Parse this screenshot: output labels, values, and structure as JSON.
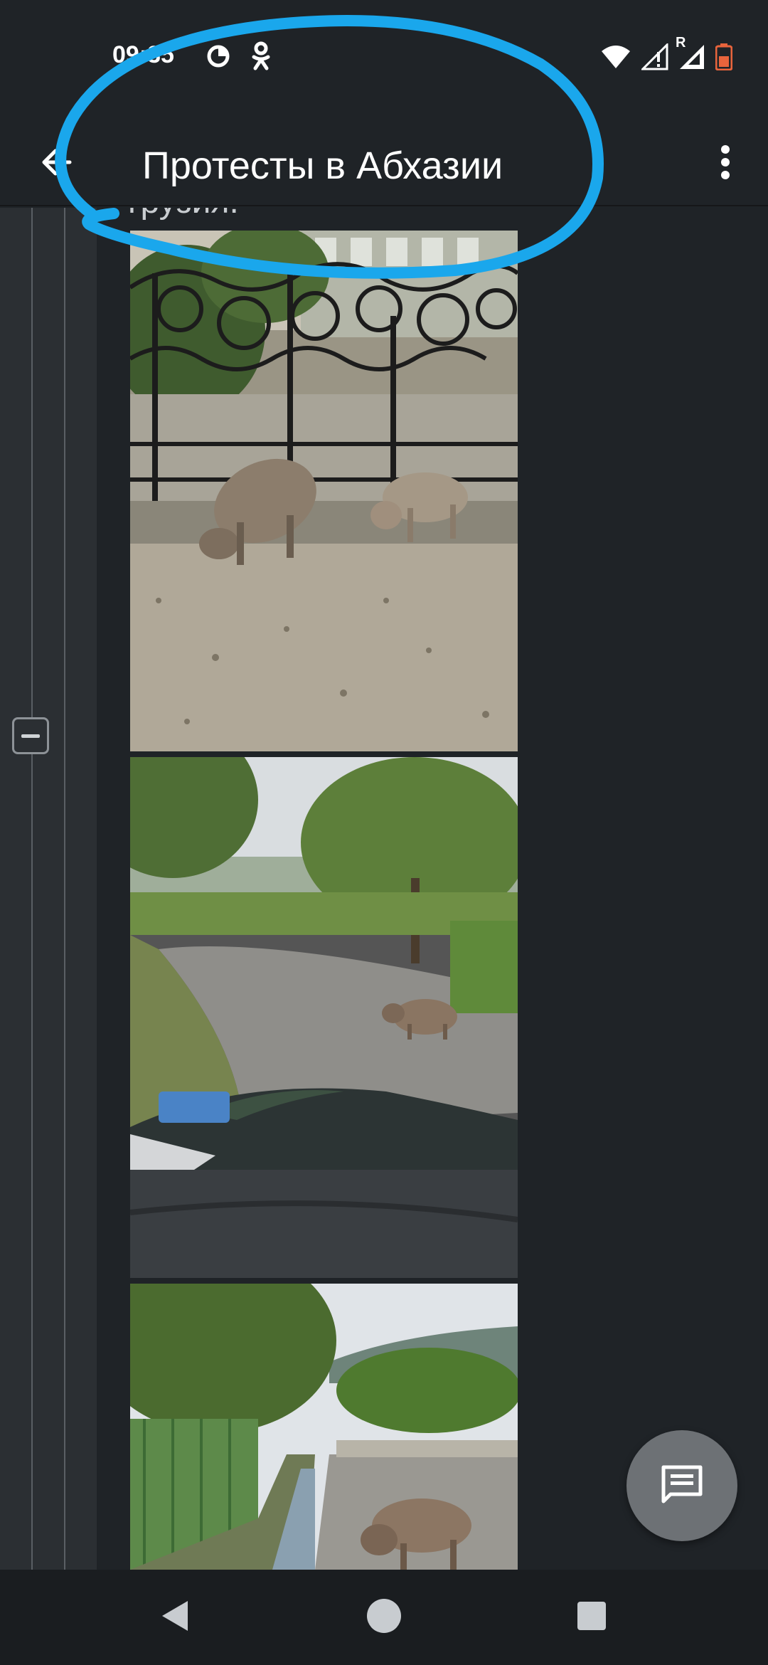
{
  "status_bar": {
    "time": "09:35",
    "icons": [
      "data-saver-icon",
      "odnoklassniki-icon",
      "wifi-icon",
      "signal-icon",
      "signal-roaming-icon",
      "battery-icon"
    ],
    "roaming_label": "R",
    "battery_color": "#e8643c"
  },
  "app_bar": {
    "title": "Протесты в Абхазии",
    "back_icon": "arrow-back-icon",
    "menu_icon": "more-vert-icon"
  },
  "content": {
    "cut_text": "грузия.",
    "images": [
      {
        "name": "pigs-by-iron-fence-photo"
      },
      {
        "name": "pig-on-road-from-car-photo"
      },
      {
        "name": "pig-by-roadside-ditch-photo"
      }
    ],
    "collapse_icon": "collapse-minus-icon"
  },
  "annotation": {
    "color": "#1aa7ec"
  },
  "fab": {
    "icon": "comment-icon",
    "color": "#6d7175"
  },
  "nav_bar": {
    "icons": [
      "nav-back-icon",
      "nav-home-icon",
      "nav-recents-icon"
    ]
  }
}
